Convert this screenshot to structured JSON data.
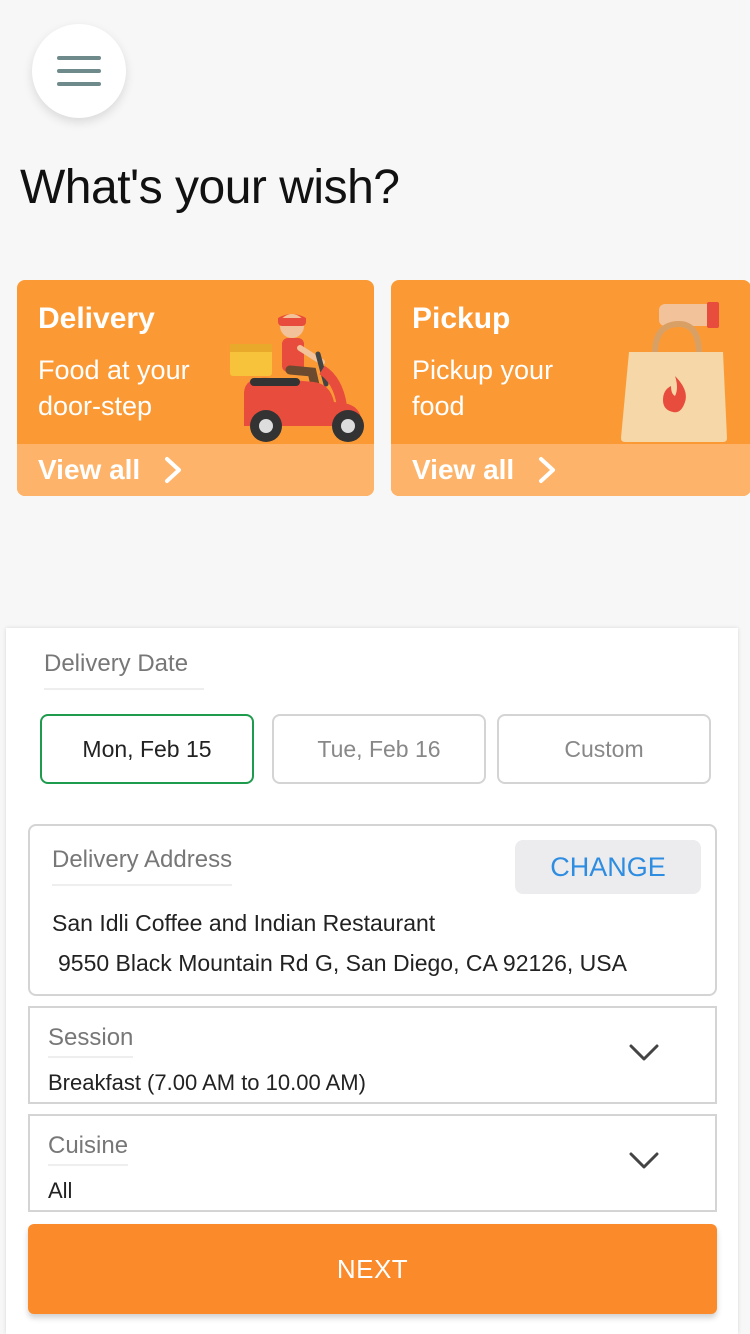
{
  "header": {
    "menu_icon": "hamburger-menu-icon",
    "title": "What's your wish?"
  },
  "cards": {
    "delivery": {
      "title": "Delivery",
      "subtitle": "Food at your door-step",
      "view_all": "View all",
      "illustration": "scooter-rider-icon"
    },
    "pickup": {
      "title": "Pickup",
      "subtitle": "Pickup your food",
      "view_all": "View all",
      "illustration": "shopping-bag-icon"
    }
  },
  "form": {
    "delivery_date_label": "Delivery Date",
    "dates": [
      {
        "label": "Mon, Feb 15",
        "selected": true
      },
      {
        "label": "Tue, Feb 16",
        "selected": false
      },
      {
        "label": "Custom",
        "selected": false
      }
    ],
    "address": {
      "label": "Delivery Address",
      "change_label": "CHANGE",
      "line1": "San Idli Coffee and Indian Restaurant",
      "line2": "9550 Black Mountain Rd G, San Diego, CA 92126, USA"
    },
    "session": {
      "label": "Session",
      "value": "Breakfast (7.00 AM to 10.00 AM)"
    },
    "cuisine": {
      "label": "Cuisine",
      "value": "All"
    },
    "next_label": "NEXT"
  },
  "colors": {
    "accent_orange": "#fb9a35",
    "card_footer": "#fdb46a",
    "next_button": "#fb8a2b",
    "selected_border": "#1f9b4e",
    "link_blue": "#2e8de0"
  }
}
